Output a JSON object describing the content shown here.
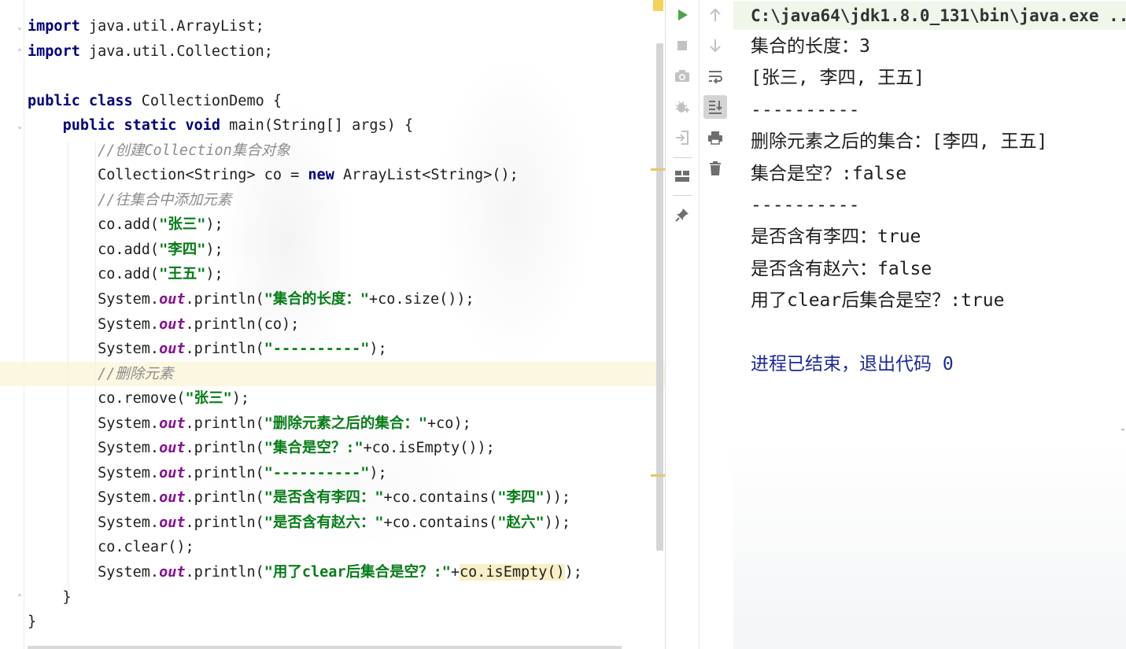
{
  "editor": {
    "lines": [
      {
        "tokens": [
          {
            "t": "kw",
            "v": "import"
          },
          {
            "t": "n",
            "v": " java.util.ArrayList;"
          }
        ]
      },
      {
        "tokens": [
          {
            "t": "kw",
            "v": "import"
          },
          {
            "t": "n",
            "v": " java.util.Collection;"
          }
        ]
      },
      {
        "tokens": []
      },
      {
        "tokens": [
          {
            "t": "kw",
            "v": "public class"
          },
          {
            "t": "n",
            "v": " CollectionDemo {"
          }
        ]
      },
      {
        "tokens": [
          {
            "t": "n",
            "v": "    "
          },
          {
            "t": "kw",
            "v": "public static void"
          },
          {
            "t": "n",
            "v": " main(String[] args) {"
          }
        ]
      },
      {
        "tokens": [
          {
            "t": "n",
            "v": "        "
          },
          {
            "t": "cmt",
            "v": "//创建Collection集合对象"
          }
        ]
      },
      {
        "tokens": [
          {
            "t": "n",
            "v": "        Collection<String> co = "
          },
          {
            "t": "kw",
            "v": "new"
          },
          {
            "t": "n",
            "v": " ArrayList<String>();"
          }
        ]
      },
      {
        "tokens": [
          {
            "t": "n",
            "v": "        "
          },
          {
            "t": "cmt",
            "v": "//往集合中添加元素"
          }
        ]
      },
      {
        "tokens": [
          {
            "t": "n",
            "v": "        co.add("
          },
          {
            "t": "str",
            "v": "\"张三\""
          },
          {
            "t": "n",
            "v": ");"
          }
        ]
      },
      {
        "tokens": [
          {
            "t": "n",
            "v": "        co.add("
          },
          {
            "t": "str",
            "v": "\"李四\""
          },
          {
            "t": "n",
            "v": ");"
          }
        ]
      },
      {
        "tokens": [
          {
            "t": "n",
            "v": "        co.add("
          },
          {
            "t": "str",
            "v": "\"王五\""
          },
          {
            "t": "n",
            "v": ");"
          }
        ]
      },
      {
        "tokens": [
          {
            "t": "n",
            "v": "        System."
          },
          {
            "t": "fld",
            "v": "out"
          },
          {
            "t": "n",
            "v": ".println("
          },
          {
            "t": "str",
            "v": "\"集合的长度：\""
          },
          {
            "t": "n",
            "v": "+co.size());"
          }
        ]
      },
      {
        "tokens": [
          {
            "t": "n",
            "v": "        System."
          },
          {
            "t": "fld",
            "v": "out"
          },
          {
            "t": "n",
            "v": ".println(co);"
          }
        ]
      },
      {
        "tokens": [
          {
            "t": "n",
            "v": "        System."
          },
          {
            "t": "fld",
            "v": "out"
          },
          {
            "t": "n",
            "v": ".println("
          },
          {
            "t": "str",
            "v": "\"----------\""
          },
          {
            "t": "n",
            "v": ");"
          }
        ]
      },
      {
        "current": true,
        "tokens": [
          {
            "t": "n",
            "v": "        "
          },
          {
            "t": "cmt",
            "v": "//删除元素"
          }
        ]
      },
      {
        "tokens": [
          {
            "t": "n",
            "v": "        co.remove("
          },
          {
            "t": "str",
            "v": "\"张三\""
          },
          {
            "t": "n",
            "v": ");"
          }
        ]
      },
      {
        "tokens": [
          {
            "t": "n",
            "v": "        System."
          },
          {
            "t": "fld",
            "v": "out"
          },
          {
            "t": "n",
            "v": ".println("
          },
          {
            "t": "str",
            "v": "\"删除元素之后的集合：\""
          },
          {
            "t": "n",
            "v": "+co);"
          }
        ]
      },
      {
        "tokens": [
          {
            "t": "n",
            "v": "        System."
          },
          {
            "t": "fld",
            "v": "out"
          },
          {
            "t": "n",
            "v": ".println("
          },
          {
            "t": "str",
            "v": "\"集合是空？:\""
          },
          {
            "t": "n",
            "v": "+co.isEmpty());"
          }
        ]
      },
      {
        "tokens": [
          {
            "t": "n",
            "v": "        System."
          },
          {
            "t": "fld",
            "v": "out"
          },
          {
            "t": "n",
            "v": ".println("
          },
          {
            "t": "str",
            "v": "\"----------\""
          },
          {
            "t": "n",
            "v": ");"
          }
        ]
      },
      {
        "tokens": [
          {
            "t": "n",
            "v": "        System."
          },
          {
            "t": "fld",
            "v": "out"
          },
          {
            "t": "n",
            "v": ".println("
          },
          {
            "t": "str",
            "v": "\"是否含有李四：\""
          },
          {
            "t": "n",
            "v": "+co.contains("
          },
          {
            "t": "str",
            "v": "\"李四\""
          },
          {
            "t": "n",
            "v": "));"
          }
        ]
      },
      {
        "tokens": [
          {
            "t": "n",
            "v": "        System."
          },
          {
            "t": "fld",
            "v": "out"
          },
          {
            "t": "n",
            "v": ".println("
          },
          {
            "t": "str",
            "v": "\"是否含有赵六：\""
          },
          {
            "t": "n",
            "v": "+co.contains("
          },
          {
            "t": "str",
            "v": "\"赵六\""
          },
          {
            "t": "n",
            "v": "));"
          }
        ]
      },
      {
        "tokens": [
          {
            "t": "n",
            "v": "        co.clear();"
          }
        ]
      },
      {
        "tokens": [
          {
            "t": "n",
            "v": "        System."
          },
          {
            "t": "fld",
            "v": "out"
          },
          {
            "t": "n",
            "v": ".println("
          },
          {
            "t": "str",
            "v": "\"用了clear后集合是空？:\""
          },
          {
            "t": "n",
            "v": "+"
          },
          {
            "t": "hl",
            "v": "co.isEmpty()"
          },
          {
            "t": "n",
            "v": ");"
          }
        ]
      },
      {
        "tokens": [
          {
            "t": "n",
            "v": "    }"
          }
        ]
      },
      {
        "tokens": [
          {
            "t": "n",
            "v": "}"
          }
        ]
      }
    ]
  },
  "run_toolbar": {
    "left": [
      {
        "name": "run-icon",
        "color": "#4ca54c"
      },
      {
        "name": "stop-icon",
        "color": "#b9b9b9"
      },
      {
        "name": "camera-icon",
        "color": "#b9b9b9"
      },
      {
        "name": "debug-bug-icon",
        "color": "#b9b9b9"
      },
      {
        "name": "login-icon",
        "color": "#b9b9b9"
      },
      {
        "name": "layout-icon",
        "color": "#6e6e6e"
      },
      {
        "name": "pin-icon",
        "color": "#6e6e6e"
      }
    ],
    "right": [
      {
        "name": "up-arrow-icon",
        "color": "#b9b9b9"
      },
      {
        "name": "down-arrow-icon",
        "color": "#b9b9b9"
      },
      {
        "name": "soft-wrap-icon",
        "color": "#6e6e6e"
      },
      {
        "name": "scroll-to-end-icon",
        "color": "#6e6e6e",
        "active": true
      },
      {
        "name": "print-icon",
        "color": "#6e6e6e"
      },
      {
        "name": "trash-icon",
        "color": "#6e6e6e"
      }
    ]
  },
  "console": {
    "command": "C:\\java64\\jdk1.8.0_131\\bin\\java.exe ...",
    "lines": [
      "集合的长度：3",
      "[张三, 李四, 王五]",
      "----------",
      "删除元素之后的集合：[李四, 王五]",
      "集合是空？:false",
      "----------",
      "是否含有李四：true",
      "是否含有赵六：false",
      "用了clear后集合是空？:true",
      ""
    ],
    "exit_message": "进程已结束，退出代码 0"
  },
  "colors": {
    "keyword": "#000080",
    "string": "#067d17",
    "comment": "#8c8c8c",
    "static_field": "#871094",
    "exit_text": "#1b2a9a",
    "command_bg": "#eef7ea"
  }
}
